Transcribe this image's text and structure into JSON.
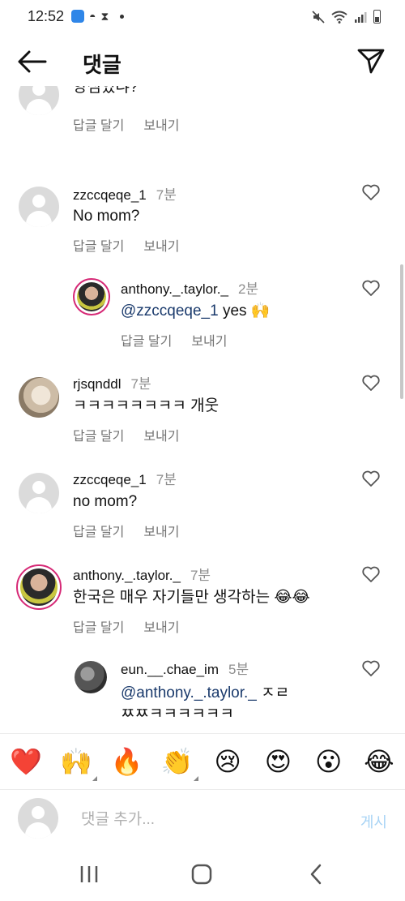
{
  "status_bar": {
    "time": "12:52"
  },
  "header": {
    "title": "댓글"
  },
  "comments": [
    {
      "username": "",
      "time_ago": "",
      "text": "양심있냐?",
      "reply_label": "답글 달기",
      "send_label": "보내기",
      "avatar": "placeholder"
    },
    {
      "username": "zzccqeqe_1",
      "time_ago": "7분",
      "text": "No mom?",
      "reply_label": "답글 달기",
      "send_label": "보내기",
      "avatar": "placeholder"
    },
    {
      "username": "anthony._.taylor._",
      "time_ago": "2분",
      "mention": "@zzccqeqe_1",
      "text": " yes 🙌",
      "reply_label": "답글 달기",
      "send_label": "보내기",
      "avatar": "story-ring"
    },
    {
      "username": "rjsqnddl",
      "time_ago": "7분",
      "text": "ㅋㅋㅋㅋㅋㅋㅋㅋ 개웃",
      "reply_label": "답글 달기",
      "send_label": "보내기",
      "avatar": "photo"
    },
    {
      "username": "zzccqeqe_1",
      "time_ago": "7분",
      "text": "no mom?",
      "reply_label": "답글 달기",
      "send_label": "보내기",
      "avatar": "placeholder"
    },
    {
      "username": "anthony._.taylor._",
      "time_ago": "7분",
      "text": "한국은 매우 자기들만 생각하는 😂😂",
      "reply_label": "답글 달기",
      "send_label": "보내기",
      "avatar": "story-ring"
    },
    {
      "username": "eun.__.chae_im",
      "time_ago": "5분",
      "mention": "@anthony._.taylor._",
      "text": " ㅈㄹ",
      "text_line2": "ㅉㅉㅋㅋㅋㅋㅋㅋ",
      "avatar": "photo"
    }
  ],
  "emoji_bar": [
    "❤️",
    "🙌",
    "🔥",
    "👏",
    "😢",
    "😍",
    "😮",
    "😂"
  ],
  "comment_input": {
    "placeholder": "댓글 추가...",
    "post_label": "게시"
  },
  "icons": {
    "back": "back-arrow-icon",
    "send": "paper-plane-icon",
    "like": "heart-outline-icon",
    "nav": [
      "recent-apps-icon",
      "home-icon",
      "back-icon"
    ]
  },
  "colors": {
    "mention": "#1a3a6c",
    "secondary_text": "#737373",
    "post_disabled": "#a7d3f5",
    "story_ring": "#d62976"
  }
}
